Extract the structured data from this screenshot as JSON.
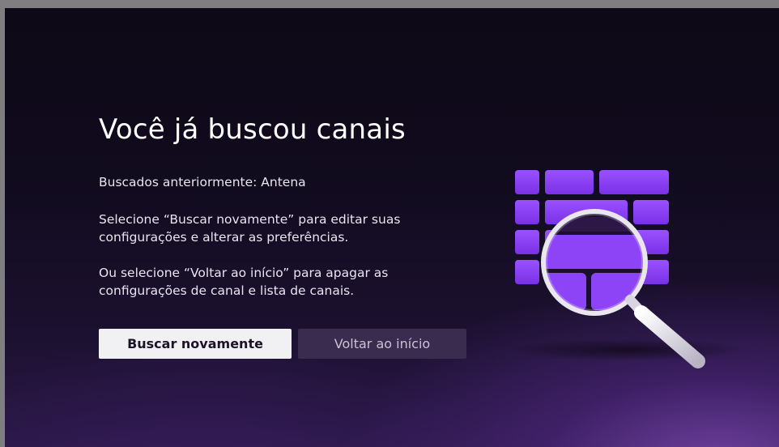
{
  "screen": {
    "title": "Você já buscou canais",
    "previous_scan": "Buscados anteriormente: Antena",
    "instruction_rescan": [
      "Selecione “Buscar novamente” para editar suas",
      "configurações e alterar as preferências."
    ],
    "instruction_home": [
      "Ou selecione “Voltar ao início” para apagar as",
      "configurações de canal e lista de canais."
    ]
  },
  "buttons": {
    "rescan_label": "Buscar novamente",
    "home_label": "Voltar ao início"
  },
  "illustration": {
    "icon": "magnifying-glass-over-channel-grid-icon"
  },
  "colors": {
    "accent": "#8b3df0",
    "background": "#110b1e",
    "button_focused": "#f1f0f2",
    "button_unfocused": "#3a2c4f"
  }
}
